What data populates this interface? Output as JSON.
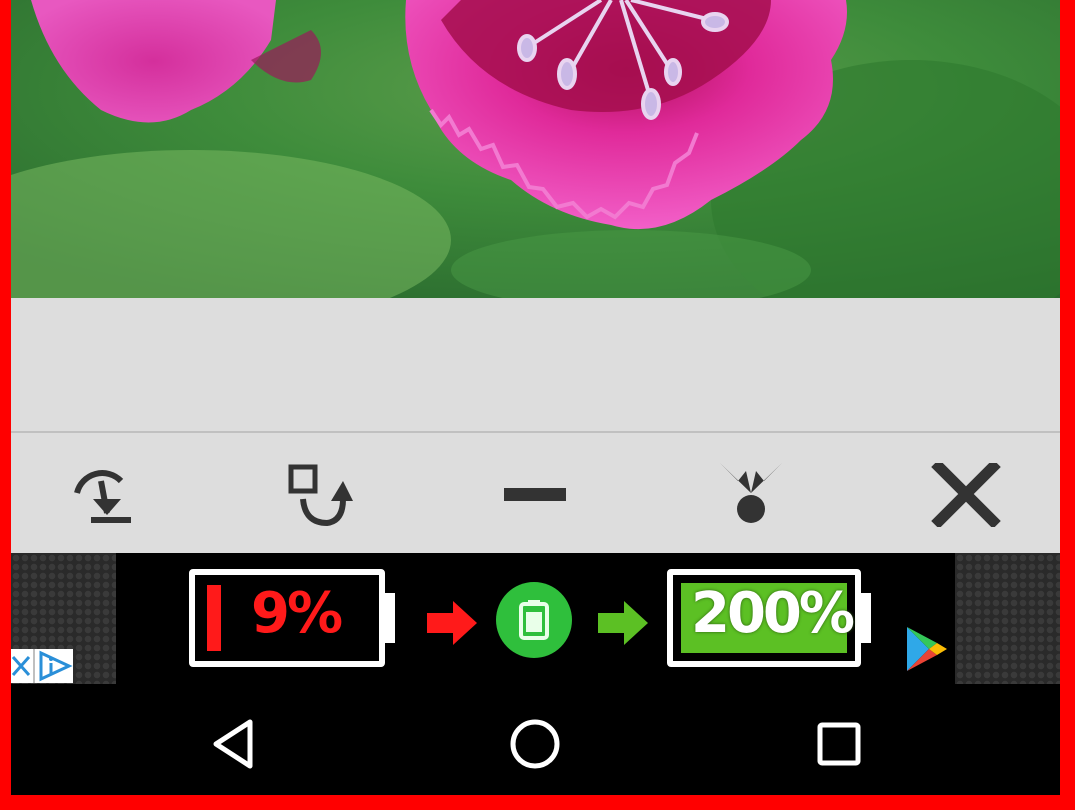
{
  "icons": {
    "toolbar": [
      "rotate-download-icon",
      "rotate-square-icon",
      "minimize-icon",
      "share-icon",
      "close-icon"
    ],
    "nav": [
      "back-icon",
      "home-icon",
      "recents-icon"
    ]
  },
  "ad": {
    "low_battery_label": "9%",
    "full_battery_label": "200%"
  },
  "colors": {
    "frame": "#ff0000",
    "panel": "#dddddd",
    "icon": "#333333",
    "ad_red": "#ff1a1a",
    "ad_green": "#5cc024"
  }
}
